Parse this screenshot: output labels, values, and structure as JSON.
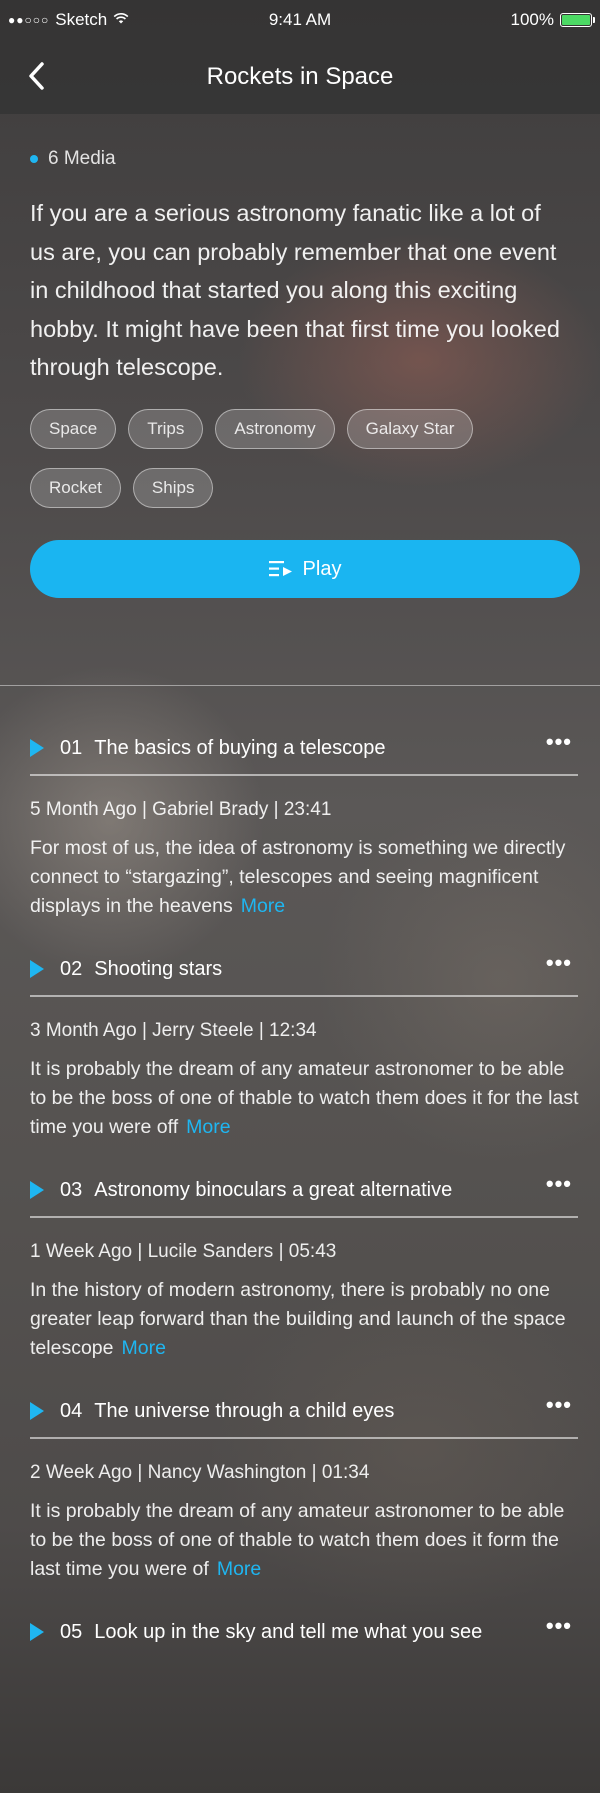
{
  "status_bar": {
    "carrier": "Sketch",
    "time": "9:41 AM",
    "battery": "100%",
    "battery_level": 1.0
  },
  "nav": {
    "title": "Rockets in Space",
    "back_icon": "chevron-left-icon"
  },
  "header": {
    "media_count": "6 Media",
    "description": "If you are a serious astronomy fanatic like a lot of us are, you can probably remember that one event in childhood that started you along this exciting hobby. It might have been that first time you looked through telescope.",
    "tags": [
      "Space",
      "Trips",
      "Astronomy",
      "Galaxy Star",
      "Rocket",
      "Ships"
    ],
    "play_label": "Play",
    "play_icon": "playlist-play-icon"
  },
  "colors": {
    "accent": "#1ab5f1"
  },
  "episodes": [
    {
      "number": "01",
      "title": "The basics of buying a telescope",
      "meta": "5 Month Ago | Gabriel Brady | 23:41",
      "description": "For most of us, the idea of astronomy is something we directly connect to “stargazing”, telescopes and seeing magnificent displays in the heavens",
      "more": "More"
    },
    {
      "number": "02",
      "title": "Shooting stars",
      "meta": "3 Month Ago | Jerry Steele | 12:34",
      "description": "It is probably the dream of any amateur astronomer to be able to be the boss of one of thable to watch them does it for the last time you were off",
      "more": "More"
    },
    {
      "number": "03",
      "title": "Astronomy binoculars a great alternative",
      "meta": "1 Week Ago | Lucile Sanders | 05:43",
      "description": "In the history of modern astronomy, there is probably no one greater leap forward than the building and launch of the space telescope",
      "more": "More"
    },
    {
      "number": "04",
      "title": "The universe through a child eyes",
      "meta": "2 Week Ago | Nancy Washington | 01:34",
      "description": "It is probably the dream of any amateur astronomer to be able to be the boss of one of thable to watch them does it form the last time you were of",
      "more": "More"
    },
    {
      "number": "05",
      "title": "Look up in the sky and tell me what you see",
      "meta": "",
      "description": "",
      "more": ""
    }
  ]
}
